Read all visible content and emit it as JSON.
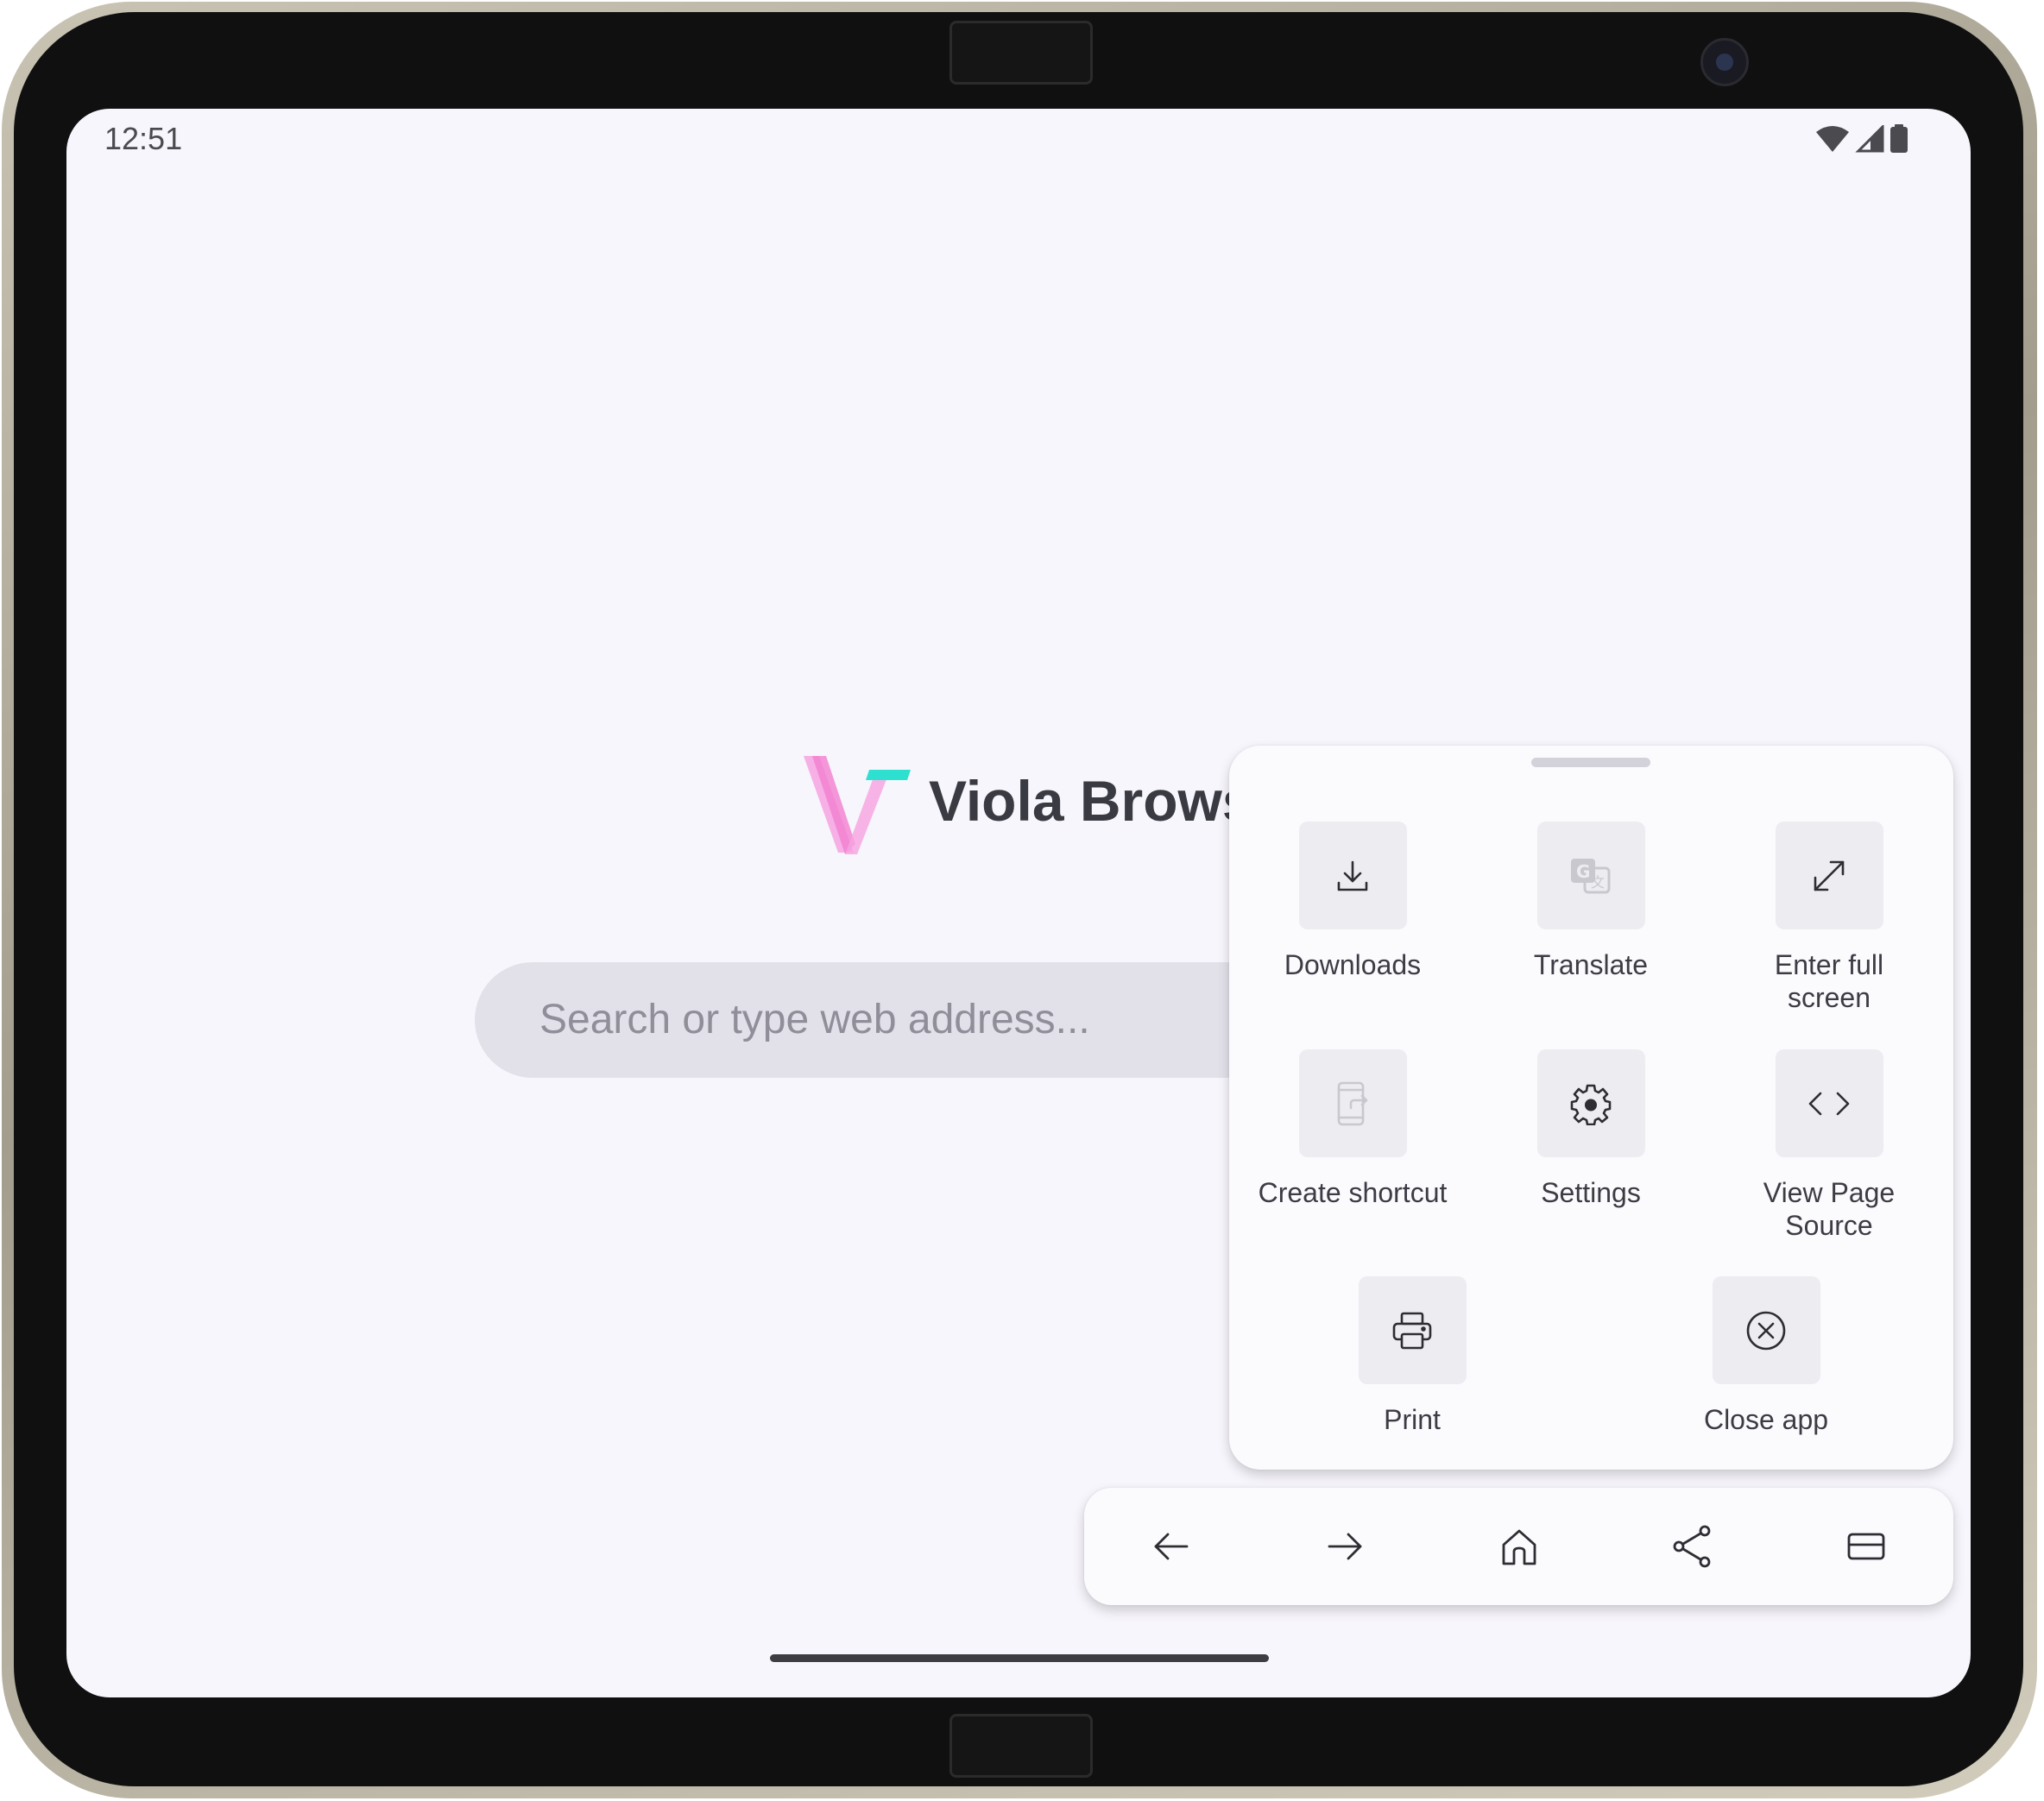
{
  "status_bar": {
    "time": "12:51",
    "icons": [
      "wifi-icon",
      "cellular-signal-icon",
      "battery-icon"
    ]
  },
  "brand": {
    "name": "Viola Browser",
    "visible_title": "Viola Brows",
    "logo": "viola-v-logo",
    "colors": {
      "pink": "#f27fd0",
      "teal": "#2de0cf"
    }
  },
  "search": {
    "placeholder": "Search or type web address..."
  },
  "menu": {
    "items": [
      {
        "label": "Downloads",
        "icon": "download-icon",
        "enabled": true
      },
      {
        "label": "Translate",
        "icon": "translate-icon",
        "enabled": false
      },
      {
        "label": "Enter full screen",
        "icon": "fullscreen-icon",
        "enabled": true
      },
      {
        "label": "Create shortcut",
        "icon": "shortcut-icon",
        "enabled": false
      },
      {
        "label": "Settings",
        "icon": "gear-icon",
        "enabled": true
      },
      {
        "label": "View Page Source",
        "icon": "code-icon",
        "enabled": true
      },
      {
        "label": "Print",
        "icon": "printer-icon",
        "enabled": true
      },
      {
        "label": "Close app",
        "icon": "close-circle-icon",
        "enabled": true
      }
    ]
  },
  "bottom_nav": {
    "buttons": [
      "back-arrow-icon",
      "forward-arrow-icon",
      "home-icon",
      "share-icon",
      "tabs-icon"
    ]
  },
  "colors": {
    "screen_background": "#f7f6fc",
    "search_bar": "#e2e1ea",
    "tile": "#ececf1",
    "text": "#3c3c44"
  }
}
